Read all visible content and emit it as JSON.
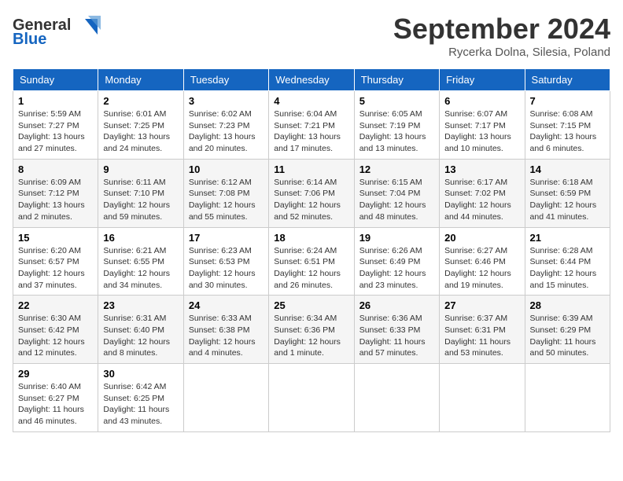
{
  "header": {
    "logo_line1": "General",
    "logo_line2": "Blue",
    "month": "September 2024",
    "location": "Rycerka Dolna, Silesia, Poland"
  },
  "weekdays": [
    "Sunday",
    "Monday",
    "Tuesday",
    "Wednesday",
    "Thursday",
    "Friday",
    "Saturday"
  ],
  "weeks": [
    [
      {
        "day": "1",
        "info": "Sunrise: 5:59 AM\nSunset: 7:27 PM\nDaylight: 13 hours\nand 27 minutes."
      },
      {
        "day": "2",
        "info": "Sunrise: 6:01 AM\nSunset: 7:25 PM\nDaylight: 13 hours\nand 24 minutes."
      },
      {
        "day": "3",
        "info": "Sunrise: 6:02 AM\nSunset: 7:23 PM\nDaylight: 13 hours\nand 20 minutes."
      },
      {
        "day": "4",
        "info": "Sunrise: 6:04 AM\nSunset: 7:21 PM\nDaylight: 13 hours\nand 17 minutes."
      },
      {
        "day": "5",
        "info": "Sunrise: 6:05 AM\nSunset: 7:19 PM\nDaylight: 13 hours\nand 13 minutes."
      },
      {
        "day": "6",
        "info": "Sunrise: 6:07 AM\nSunset: 7:17 PM\nDaylight: 13 hours\nand 10 minutes."
      },
      {
        "day": "7",
        "info": "Sunrise: 6:08 AM\nSunset: 7:15 PM\nDaylight: 13 hours\nand 6 minutes."
      }
    ],
    [
      {
        "day": "8",
        "info": "Sunrise: 6:09 AM\nSunset: 7:12 PM\nDaylight: 13 hours\nand 2 minutes."
      },
      {
        "day": "9",
        "info": "Sunrise: 6:11 AM\nSunset: 7:10 PM\nDaylight: 12 hours\nand 59 minutes."
      },
      {
        "day": "10",
        "info": "Sunrise: 6:12 AM\nSunset: 7:08 PM\nDaylight: 12 hours\nand 55 minutes."
      },
      {
        "day": "11",
        "info": "Sunrise: 6:14 AM\nSunset: 7:06 PM\nDaylight: 12 hours\nand 52 minutes."
      },
      {
        "day": "12",
        "info": "Sunrise: 6:15 AM\nSunset: 7:04 PM\nDaylight: 12 hours\nand 48 minutes."
      },
      {
        "day": "13",
        "info": "Sunrise: 6:17 AM\nSunset: 7:02 PM\nDaylight: 12 hours\nand 44 minutes."
      },
      {
        "day": "14",
        "info": "Sunrise: 6:18 AM\nSunset: 6:59 PM\nDaylight: 12 hours\nand 41 minutes."
      }
    ],
    [
      {
        "day": "15",
        "info": "Sunrise: 6:20 AM\nSunset: 6:57 PM\nDaylight: 12 hours\nand 37 minutes."
      },
      {
        "day": "16",
        "info": "Sunrise: 6:21 AM\nSunset: 6:55 PM\nDaylight: 12 hours\nand 34 minutes."
      },
      {
        "day": "17",
        "info": "Sunrise: 6:23 AM\nSunset: 6:53 PM\nDaylight: 12 hours\nand 30 minutes."
      },
      {
        "day": "18",
        "info": "Sunrise: 6:24 AM\nSunset: 6:51 PM\nDaylight: 12 hours\nand 26 minutes."
      },
      {
        "day": "19",
        "info": "Sunrise: 6:26 AM\nSunset: 6:49 PM\nDaylight: 12 hours\nand 23 minutes."
      },
      {
        "day": "20",
        "info": "Sunrise: 6:27 AM\nSunset: 6:46 PM\nDaylight: 12 hours\nand 19 minutes."
      },
      {
        "day": "21",
        "info": "Sunrise: 6:28 AM\nSunset: 6:44 PM\nDaylight: 12 hours\nand 15 minutes."
      }
    ],
    [
      {
        "day": "22",
        "info": "Sunrise: 6:30 AM\nSunset: 6:42 PM\nDaylight: 12 hours\nand 12 minutes."
      },
      {
        "day": "23",
        "info": "Sunrise: 6:31 AM\nSunset: 6:40 PM\nDaylight: 12 hours\nand 8 minutes."
      },
      {
        "day": "24",
        "info": "Sunrise: 6:33 AM\nSunset: 6:38 PM\nDaylight: 12 hours\nand 4 minutes."
      },
      {
        "day": "25",
        "info": "Sunrise: 6:34 AM\nSunset: 6:36 PM\nDaylight: 12 hours\nand 1 minute."
      },
      {
        "day": "26",
        "info": "Sunrise: 6:36 AM\nSunset: 6:33 PM\nDaylight: 11 hours\nand 57 minutes."
      },
      {
        "day": "27",
        "info": "Sunrise: 6:37 AM\nSunset: 6:31 PM\nDaylight: 11 hours\nand 53 minutes."
      },
      {
        "day": "28",
        "info": "Sunrise: 6:39 AM\nSunset: 6:29 PM\nDaylight: 11 hours\nand 50 minutes."
      }
    ],
    [
      {
        "day": "29",
        "info": "Sunrise: 6:40 AM\nSunset: 6:27 PM\nDaylight: 11 hours\nand 46 minutes."
      },
      {
        "day": "30",
        "info": "Sunrise: 6:42 AM\nSunset: 6:25 PM\nDaylight: 11 hours\nand 43 minutes."
      },
      null,
      null,
      null,
      null,
      null
    ]
  ]
}
